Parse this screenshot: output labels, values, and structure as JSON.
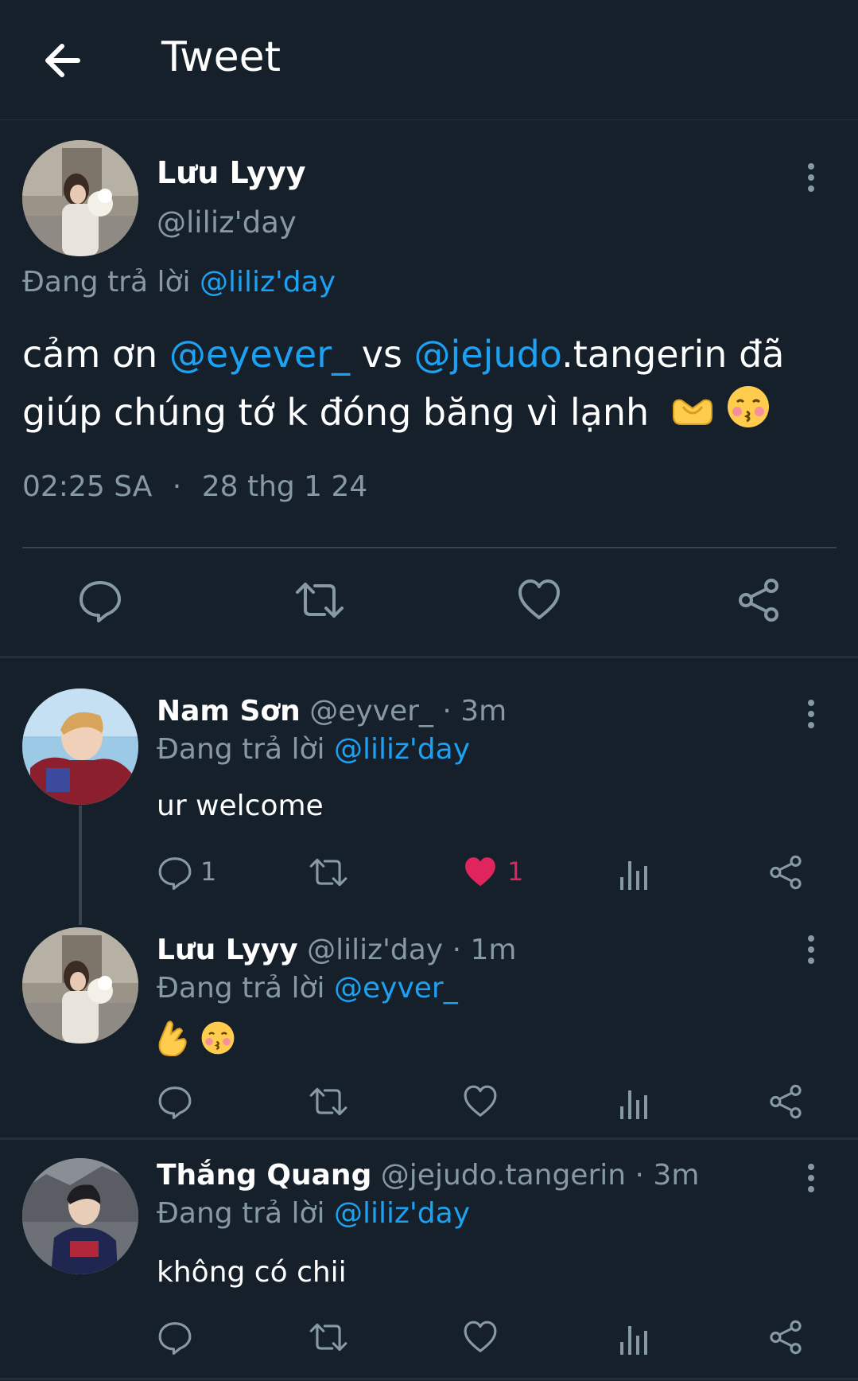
{
  "header": {
    "title": "Tweet"
  },
  "main_tweet": {
    "author_name": "Lưu Lyyy",
    "author_handle": "@liliz'day",
    "replying_prefix": "Đang trả lời",
    "replying_to": "@liliz'day",
    "text_part1": "cảm ơn ",
    "mention1": "@eyever_",
    "text_part2": " vs ",
    "mention2": "@jejudo",
    "text_part3": ".tangerin đã giúp chúng tớ k đóng băng vì lạnh",
    "time": "02:25 SA",
    "separator": "·",
    "date": "28 thg 1 24",
    "icons": [
      "reply-icon",
      "retweet-icon",
      "like-icon",
      "share-icon"
    ]
  },
  "replies": [
    {
      "name": "Nam Sơn",
      "handle": "@eyver_",
      "time": "· 3m",
      "replying_prefix": "Đang trả lời",
      "replying_to": "@liliz'day",
      "text": "ur welcome",
      "reply_count": "1",
      "like_count": "1",
      "liked": true
    },
    {
      "name": "Lưu Lyyy",
      "handle": "@liliz'day",
      "time": "· 1m",
      "replying_prefix": "Đang trả lời",
      "replying_to": "@eyver_",
      "text": "",
      "reply_count": "",
      "like_count": "",
      "liked": false
    },
    {
      "name": "Thắng Quang",
      "handle": "@jejudo.tangerin",
      "time": "· 3m",
      "replying_prefix": "Đang trả lời",
      "replying_to": "@liliz'day",
      "text": "không có chii",
      "reply_count": "",
      "like_count": "",
      "liked": false
    }
  ],
  "colors": {
    "background": "#15202b",
    "muted": "#8899a6",
    "link": "#1da1f2",
    "like": "#e0245e"
  }
}
